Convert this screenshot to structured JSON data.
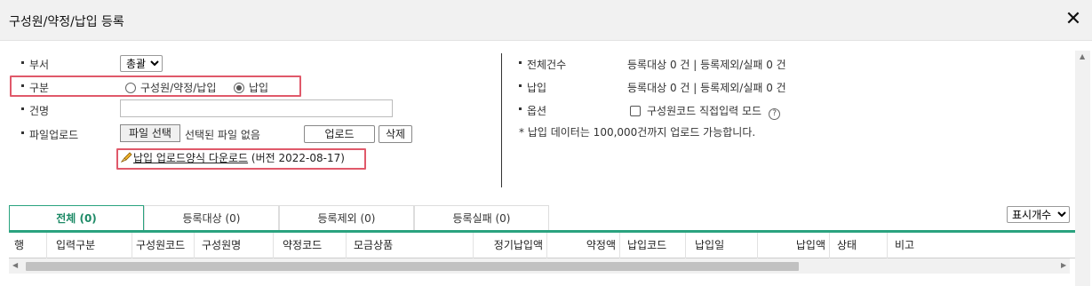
{
  "window": {
    "title": "구성원/약정/납입 등록",
    "close_glyph": "✕"
  },
  "form": {
    "dept": {
      "label": "부서",
      "selected": "총괄"
    },
    "type": {
      "label": "구분",
      "options": [
        "구성원/약정/납입",
        "납입"
      ],
      "selected_index": 1
    },
    "name": {
      "label": "건명",
      "value": ""
    },
    "upload": {
      "label": "파일업로드",
      "choose_button": "파일 선택",
      "no_file_text": "선택된 파일 없음",
      "upload_button": "업로드",
      "delete_button": "삭제"
    },
    "download": {
      "link_text": "납입 업로드양식 다운로드",
      "version_text": "(버전 2022-08-17)",
      "icon": "pencil-hand-icon"
    }
  },
  "summary": {
    "total": {
      "label": "전체건수",
      "value": "등록대상 0 건 | 등록제외/실패 0 건"
    },
    "payment": {
      "label": "납입",
      "value": "등록대상 0 건 | 등록제외/실패 0 건"
    },
    "options": {
      "label": "옵션",
      "checkbox_label": "구성원코드 직접입력 모드",
      "checked": false,
      "help_glyph": "?"
    },
    "note": "* 납입 데이터는 100,000건까지 업로드 가능합니다."
  },
  "tabs": [
    {
      "label": "전체 (0)",
      "active": true
    },
    {
      "label": "등록대상 (0)",
      "active": false
    },
    {
      "label": "등록제외 (0)",
      "active": false
    },
    {
      "label": "등록실패 (0)",
      "active": false
    }
  ],
  "display_count": {
    "selected": "표시개수"
  },
  "table": {
    "columns": [
      "행",
      "입력구분",
      "구성원코드",
      "구성원명",
      "약정코드",
      "모금상품",
      "정기납입액",
      "약정액",
      "납입코드",
      "납입일",
      "납입액",
      "상태",
      "비고"
    ],
    "rows": []
  },
  "colors": {
    "accent": "#2aa37f",
    "highlight_box": "#e0596a"
  }
}
